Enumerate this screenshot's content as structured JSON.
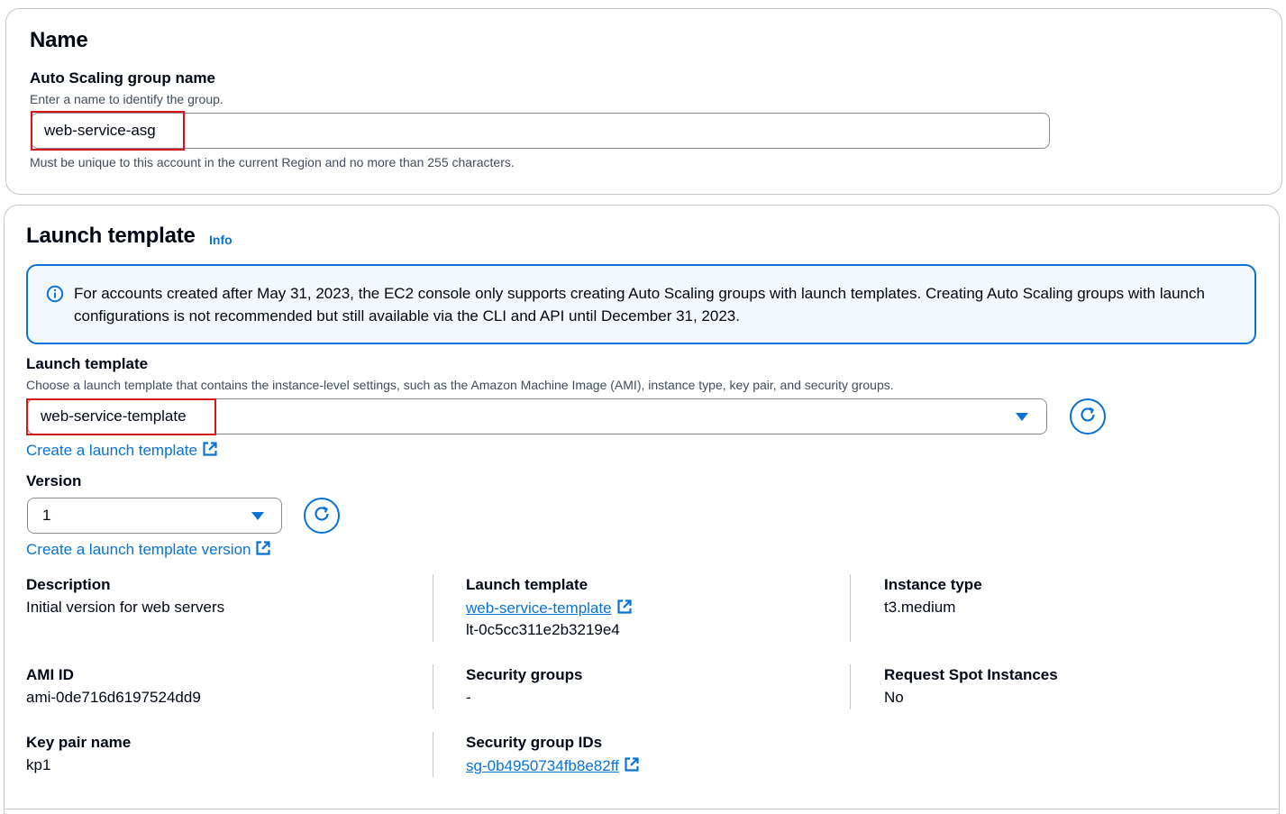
{
  "name_section": {
    "title": "Name",
    "field_label": "Auto Scaling group name",
    "field_description": "Enter a name to identify the group.",
    "field_value": "web-service-asg",
    "constraint": "Must be unique to this account in the current Region and no more than 255 characters."
  },
  "launch_section": {
    "title": "Launch template",
    "info_link": "Info",
    "alert_text": "For accounts created after May 31, 2023, the EC2 console only supports creating Auto Scaling groups with launch templates. Creating Auto Scaling groups with launch configurations is not recommended but still available via the CLI and API until December 31, 2023.",
    "template_label": "Launch template",
    "template_description": "Choose a launch template that contains the instance-level settings, such as the Amazon Machine Image (AMI), instance type, key pair, and security groups.",
    "template_selected": "web-service-template",
    "create_template_link": "Create a launch template",
    "version_label": "Version",
    "version_selected": "1",
    "create_version_link": "Create a launch template version"
  },
  "details": {
    "description": {
      "label": "Description",
      "value": "Initial version for web servers"
    },
    "launch_template": {
      "label": "Launch template",
      "link": "web-service-template",
      "id": "lt-0c5cc311e2b3219e4"
    },
    "instance_type": {
      "label": "Instance type",
      "value": "t3.medium"
    },
    "ami_id": {
      "label": "AMI ID",
      "value": "ami-0de716d6197524dd9"
    },
    "security_groups": {
      "label": "Security groups",
      "value": "-"
    },
    "request_spot": {
      "label": "Request Spot Instances",
      "value": "No"
    },
    "key_pair": {
      "label": "Key pair name",
      "value": "kp1"
    },
    "security_group_ids": {
      "label": "Security group IDs",
      "link": "sg-0b4950734fb8e82ff"
    }
  },
  "colors": {
    "accent": "#0972d3",
    "highlight_box": "#d91515",
    "alert_bg": "#f2f8fd",
    "border": "#c6c6cd"
  },
  "icons": {
    "alert": "info-circle-icon",
    "refresh": "refresh-icon",
    "dropdown": "caret-down-icon",
    "external": "external-link-icon"
  }
}
